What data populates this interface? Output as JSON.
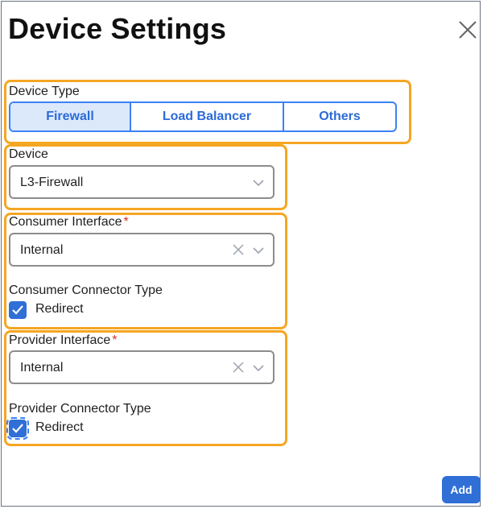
{
  "dialog": {
    "title": "Device Settings",
    "close_icon": "close-icon",
    "device_type": {
      "label": "Device Type",
      "options": [
        "Firewall",
        "Load Balancer",
        "Others"
      ],
      "selected": "Firewall"
    },
    "device": {
      "label": "Device",
      "value": "L3-Firewall"
    },
    "consumer_interface": {
      "label": "Consumer Interface",
      "required_mark": "*",
      "value": "Internal",
      "connector_type_label": "Consumer Connector Type",
      "redirect_label": "Redirect",
      "redirect_checked": true
    },
    "provider_interface": {
      "label": "Provider Interface",
      "required_mark": "*",
      "value": "Internal",
      "connector_type_label": "Provider Connector Type",
      "redirect_label": "Redirect",
      "redirect_checked": true
    },
    "add_label": "Add"
  },
  "colors": {
    "accent": "#2f6fd6",
    "highlight": "#f5a623",
    "required": "#d92d20",
    "segment_active_bg": "#dce9fb"
  }
}
